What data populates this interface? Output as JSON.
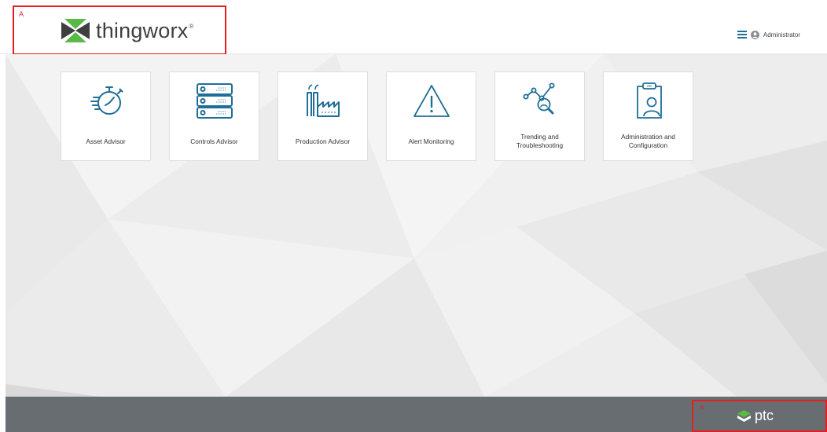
{
  "header": {
    "brand": "thingworx",
    "brand_mark": "®",
    "user_name": "Administrator"
  },
  "annotations": {
    "a": "A",
    "b": "B"
  },
  "tiles": [
    {
      "label": "Asset Advisor",
      "icon": "stopwatch-icon"
    },
    {
      "label": "Controls Advisor",
      "icon": "server-rack-icon"
    },
    {
      "label": "Production Advisor",
      "icon": "factory-icon"
    },
    {
      "label": "Alert Monitoring",
      "icon": "warning-triangle-icon"
    },
    {
      "label": "Trending and Troubleshooting",
      "icon": "graph-magnifier-icon"
    },
    {
      "label": "Administration and Configuration",
      "icon": "clipboard-user-icon"
    }
  ],
  "footer": {
    "brand": "ptc"
  },
  "colors": {
    "icon_blue": "#1f6e98",
    "footer_gray": "#676d71",
    "annotation_red": "#e51f1f",
    "logo_green": "#58b947",
    "logo_dark": "#3f3f3f"
  }
}
